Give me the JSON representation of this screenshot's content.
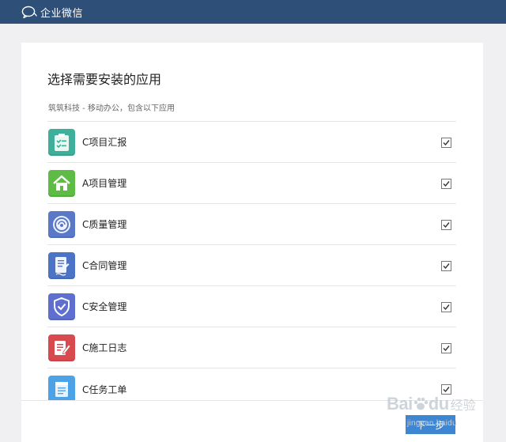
{
  "header": {
    "brand": "企业微信"
  },
  "dialog": {
    "title": "选择需要安装的应用",
    "subtitle": "筑筑科技 - 移动办公，包含以下应用",
    "apps": [
      {
        "name": "C项目汇报",
        "icon": "report-clipboard-icon",
        "color": "#3daf9b",
        "checked": true
      },
      {
        "name": "A项目管理",
        "icon": "home-icon",
        "color": "#5dbb46",
        "checked": true
      },
      {
        "name": "C质量管理",
        "icon": "quality-badge-icon",
        "color": "#5a78c8",
        "checked": true
      },
      {
        "name": "C合同管理",
        "icon": "contract-document-icon",
        "color": "#4c73c6",
        "checked": true
      },
      {
        "name": "C安全管理",
        "icon": "shield-check-icon",
        "color": "#5e6fd0",
        "checked": true
      },
      {
        "name": "C施工日志",
        "icon": "notebook-pen-icon",
        "color": "#d94a4f",
        "checked": true
      },
      {
        "name": "C任务工单",
        "icon": "task-list-icon",
        "color": "#4ca2e6",
        "checked": true
      }
    ],
    "next_label": "下一步"
  },
  "watermark": {
    "brand": "Bai",
    "brand_suffix": "du",
    "cn": "经验",
    "url": "jingyan.baidu"
  }
}
